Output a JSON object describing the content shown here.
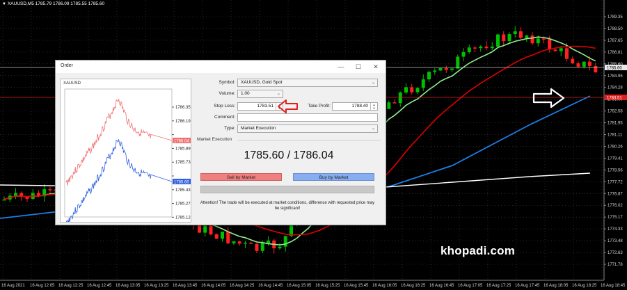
{
  "chart": {
    "title": "XAUUSD,M5  1785.79 1786.09 1785.55 1785.60",
    "watermark": "khopadi.com",
    "price_axis": [
      "1789.35",
      "1788.50",
      "1787.65",
      "1786.81",
      "1785.60",
      "1784.95",
      "1784.28",
      "1783.60",
      "1782.58",
      "1781.95",
      "1781.11",
      "1780.26",
      "1779.41",
      "1778.56",
      "1777.72",
      "1776.87",
      "1776.02",
      "1775.17",
      "1774.33",
      "1773.48",
      "1772.63",
      "1771.78"
    ],
    "current_bid_label": "1785.60",
    "current_sl_label": "1783.51",
    "time_axis": [
      "16 Aug 2021",
      "16 Aug 12:05",
      "16 Aug 12:25",
      "16 Aug 12:45",
      "16 Aug 13:05",
      "16 Aug 13:25",
      "16 Aug 13:45",
      "16 Aug 14:05",
      "16 Aug 14:25",
      "16 Aug 14:45",
      "16 Aug 15:05",
      "16 Aug 15:25",
      "16 Aug 15:45",
      "16 Aug 16:05",
      "16 Aug 16:25",
      "16 Aug 16:45",
      "16 Aug 17:05",
      "16 Aug 17:25",
      "16 Aug 17:45",
      "16 Aug 18:05",
      "16 Aug 18:25",
      "16 Aug 18:45"
    ],
    "colors": {
      "bull": "#00c000",
      "bear": "#ff2020",
      "ma_fast": "#90ee90",
      "ma_mid": "#e00000",
      "ma_slow": "#1e7ee6",
      "ma_long": "#ffffff",
      "grid": "#444444"
    }
  },
  "dialog": {
    "title": "Order",
    "mini_chart": {
      "symbol": "XAUUSD",
      "price_labels": [
        "1786.35",
        "1786.19",
        "1786.04",
        "1785.89",
        "1785.73",
        "1785.60",
        "1785.43",
        "1785.27",
        "1785.12",
        "1784.97"
      ],
      "ask_label": "1786.04",
      "bid_label": "1785.60"
    },
    "labels": {
      "symbol": "Symbol:",
      "volume": "Volume:",
      "stop_loss": "Stop Loss:",
      "take_profit": "Take Profit:",
      "comment": "Comment:",
      "type": "Type:"
    },
    "values": {
      "symbol": "XAUUSD, Gold Spot",
      "volume": "1.00",
      "stop_loss": "1783.51",
      "take_profit": "1788.40",
      "comment": "",
      "type": "Market Execution"
    },
    "section_label": "Market Execution",
    "quote": "1785.60 / 1786.04",
    "sell_label": "Sell by Market",
    "buy_label": "Buy by Market",
    "attention": "Attention! The trade will be executed at market conditions, difference with requested price may be significant!",
    "colors": {
      "sell": "#f08080",
      "buy": "#88aef0"
    }
  }
}
